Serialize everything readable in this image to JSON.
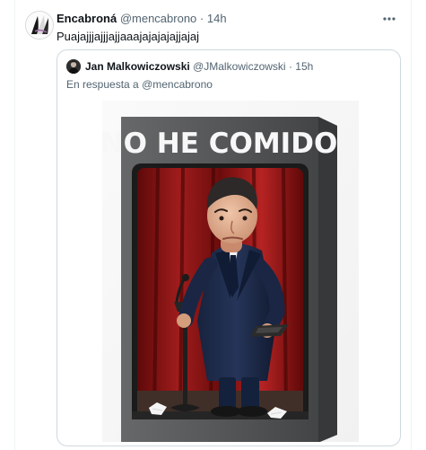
{
  "tweet": {
    "display_name": "Encabroná",
    "handle": "@mencabrono",
    "separator": "·",
    "time": "14h",
    "text": "Puajajjjajjjajjaaajajajajajjajaj",
    "more_icon": "more-horizontal-icon"
  },
  "quoted": {
    "display_name": "Jan Malkowiczowski",
    "handle": "@JMalkowiczowski",
    "separator": "·",
    "time": "15h",
    "reply_prefix": "En respuesta a",
    "reply_to": "@mencabrono",
    "image": {
      "box_title": "NO HE COMIDO"
    }
  },
  "colors": {
    "text": "#0f1419",
    "muted": "#536471",
    "border": "#cfd9de",
    "box": "#555758",
    "curtain": "#8f1515"
  }
}
